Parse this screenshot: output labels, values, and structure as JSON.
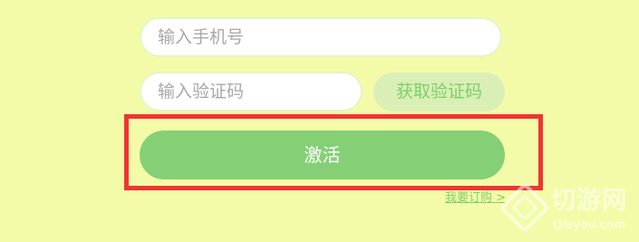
{
  "form": {
    "phone_placeholder": "输入手机号",
    "code_placeholder": "输入验证码",
    "get_code_label": "获取验证码",
    "activate_label": "激活",
    "subscribe_link": "我要订购 >"
  },
  "watermark": {
    "text_cn": "切游网",
    "text_en": "Qieyou.com",
    "icon": "qieyou-logo-icon"
  },
  "colors": {
    "background": "#f4fba8",
    "accent_green": "#85d076",
    "highlight_red": "#ee3535"
  }
}
